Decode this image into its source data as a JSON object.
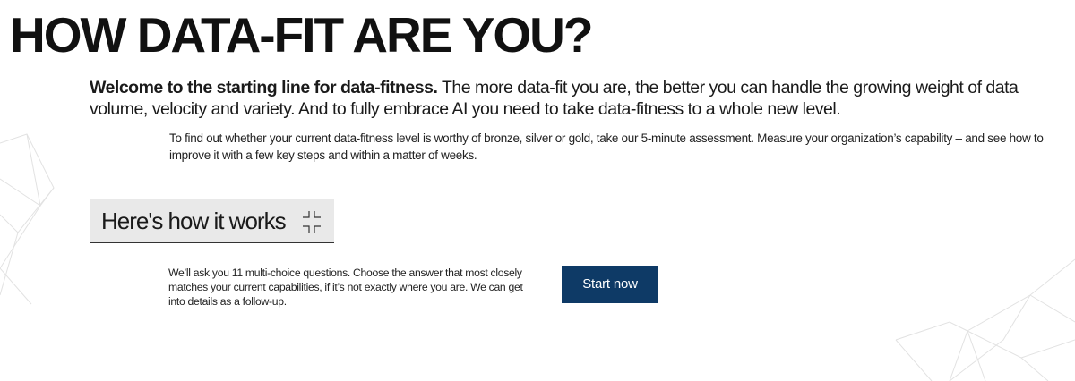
{
  "header": {
    "title": "HOW DATA-FIT ARE YOU?"
  },
  "intro": {
    "lead_bold": "Welcome to the starting line for data-fitness.",
    "lead_rest": " The more data-fit you are, the better you can handle the growing weight of data volume, velocity and variety. And to fully embrace AI you need to take data-fitness to a whole new level."
  },
  "sub_intro": {
    "text": "To find out whether your current data-fitness level is worthy of bronze, silver or gold, take our 5-minute assessment. Measure your organization’s capability – and see how to improve it with a few key steps and within a matter of weeks."
  },
  "how_it_works": {
    "tab_label": "Here's how it works",
    "collapse_icon": "collapse-icon",
    "description": "We’ll ask you 11 multi-choice questions. Choose the answer that most closely matches your current capabilities, if it’s not exactly where you are. We can get into details as a follow-up.",
    "start_button_label": "Start now"
  },
  "colors": {
    "button_background": "#0e3a66",
    "tab_background": "#e9e9e9",
    "text": "#111111",
    "decor_lines": "#dddddd"
  }
}
